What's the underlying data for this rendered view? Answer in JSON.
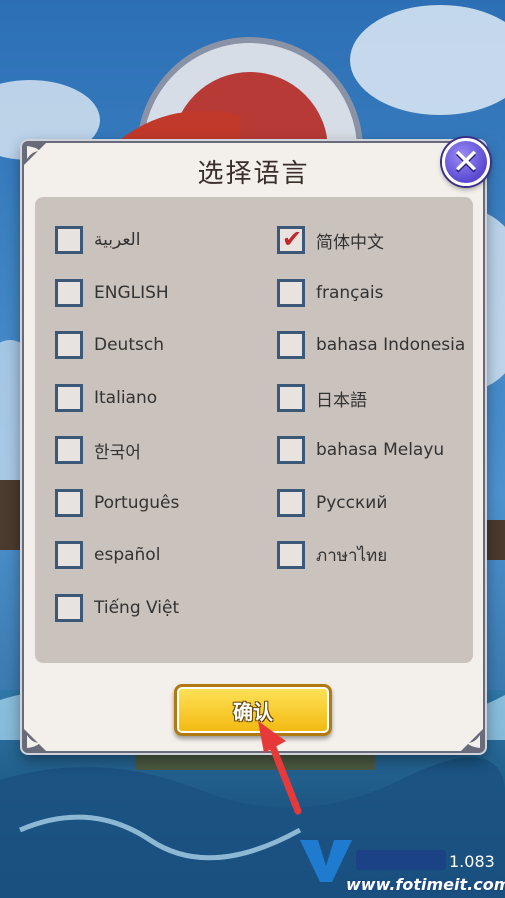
{
  "dialog": {
    "title": "选择语言",
    "confirm_label": "确认"
  },
  "languages": {
    "left": [
      {
        "label": "العربية",
        "checked": false
      },
      {
        "label": "ENGLISH",
        "checked": false
      },
      {
        "label": "Deutsch",
        "checked": false
      },
      {
        "label": "Italiano",
        "checked": false
      },
      {
        "label": "한국어",
        "checked": false
      },
      {
        "label": "Português",
        "checked": false
      },
      {
        "label": "español",
        "checked": false
      },
      {
        "label": "Tiếng Việt",
        "checked": false
      }
    ],
    "right": [
      {
        "label": "简体中文",
        "checked": true
      },
      {
        "label": "français",
        "checked": false
      },
      {
        "label": "bahasa Indonesia",
        "checked": false
      },
      {
        "label": "日本語",
        "checked": false
      },
      {
        "label": "bahasa Melayu",
        "checked": false
      },
      {
        "label": "Русский",
        "checked": false
      },
      {
        "label": "ภาษาไทย",
        "checked": false
      }
    ]
  },
  "footer": {
    "version": "1.083",
    "watermark_url": "www.fotimeit.com"
  },
  "colors": {
    "check": "#c0282e",
    "checkbox_border": "#3b5878",
    "close_button": "#5a49d1",
    "confirm_button": "#f2b80f"
  }
}
